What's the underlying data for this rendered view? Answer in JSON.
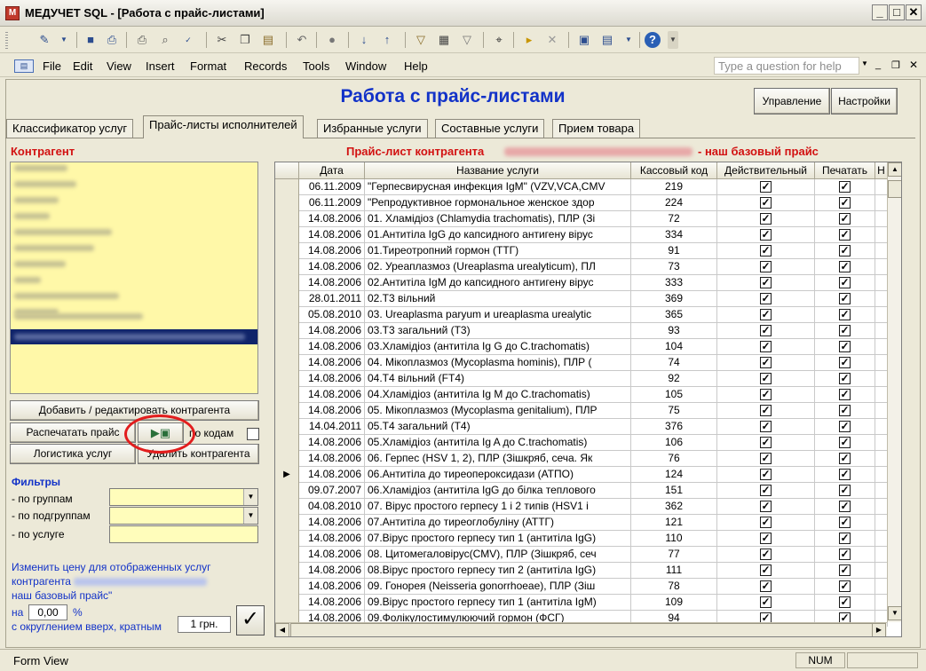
{
  "window": {
    "title": "МЕДУЧЕТ SQL - [Работа с прайс-листами]",
    "app_icon_letter": "M"
  },
  "menu": [
    "File",
    "Edit",
    "View",
    "Insert",
    "Format",
    "Records",
    "Tools",
    "Window",
    "Help"
  ],
  "help_placeholder": "Type a question for help",
  "form": {
    "title": "Работа с прайс-листами",
    "buttons": {
      "manage": "Управление",
      "settings": "Настройки"
    },
    "tabs": [
      "Классификатор услуг",
      "Прайс-листы исполнителей",
      "Избранные услуги",
      "Составные услуги",
      "Прием товара"
    ],
    "active_tab": 1
  },
  "left": {
    "title": "Контрагент",
    "buttons": {
      "add_edit": "Добавить / редактировать контрагента",
      "print_price": "Распечатать прайс",
      "by_codes": "по кодам",
      "logistics": "Логистика услуг",
      "delete": "Удалить контрагента"
    },
    "filters": {
      "title": "Фильтры",
      "by_group": "- по группам",
      "by_subgroup": "- по подгруппам",
      "by_service": "- по услуге"
    },
    "price_change": {
      "line1": "Изменить цену для отображенных услуг",
      "line2_prefix": "контрагента",
      "line3": "наш базовый прайс\"",
      "on_label": "на",
      "percent_value": "0,00",
      "percent_sign": "%",
      "rounding_label": "с округлением вверх, кратным",
      "rounding_value": "1 грн."
    }
  },
  "right": {
    "title_prefix": "Прайс-лист контрагента",
    "title_suffix": "- наш базовый прайс"
  },
  "grid": {
    "columns": [
      "Дата",
      "Название услуги",
      "Кассовый код",
      "Действительный",
      "Печатать",
      "Н"
    ],
    "current_row": 18,
    "rows": [
      [
        "06.11.2009",
        "\"Герпесвирусная инфекция IgM\" (VZV,VCA,CMV",
        "219"
      ],
      [
        "06.11.2009",
        "\"Репродуктивное гормональное женское здор",
        "224"
      ],
      [
        "14.08.2006",
        "01. Хламідіоз (Chlamydia trachomatis), ПЛР (Зі",
        "72"
      ],
      [
        "14.08.2006",
        "01.Антитіла IgG до капсидного антигену вірус",
        "334"
      ],
      [
        "14.08.2006",
        "01.Тиреотропний гормон (ТТГ)",
        "91"
      ],
      [
        "14.08.2006",
        "02. Уреаплазмоз (Ureaplasma urealyticum), ПЛ",
        "73"
      ],
      [
        "14.08.2006",
        "02.Антитіла IgM до капсидного антигену вірус",
        "333"
      ],
      [
        "28.01.2011",
        "02.Т3 вільний",
        "369"
      ],
      [
        "05.08.2010",
        "03. Ureaplasma paryum и ureaplasma urealytic",
        "365"
      ],
      [
        "14.08.2006",
        "03.Т3 загальний (Т3)",
        "93"
      ],
      [
        "14.08.2006",
        "03.Хламідіоз (антитіла Ig G до C.trachomatis)",
        "104"
      ],
      [
        "14.08.2006",
        "04. Мікоплазмоз (Mycoplasma hominis), ПЛР (",
        "74"
      ],
      [
        "14.08.2006",
        "04.Т4 вільний (FT4)",
        "92"
      ],
      [
        "14.08.2006",
        "04.Хламідіоз (антитіла Ig M до C.trachomatis)",
        "105"
      ],
      [
        "14.08.2006",
        "05. Мікоплазмоз (Mycoplasma genitalium), ПЛР",
        "75"
      ],
      [
        "14.04.2011",
        "05.Т4 загальний (Т4)",
        "376"
      ],
      [
        "14.08.2006",
        "05.Хламідіоз (антитіла Ig A до C.trachomatis)",
        "106"
      ],
      [
        "14.08.2006",
        "06. Герпес (HSV 1, 2), ПЛР (Зішкряб, сеча. Як",
        "76"
      ],
      [
        "14.08.2006",
        "06.Антитіла до тиреопероксидази (АТПО)",
        "124"
      ],
      [
        "09.07.2007",
        "06.Хламідіоз (антитіла IgG до білка теплового",
        "151"
      ],
      [
        "04.08.2010",
        "07. Вірус простого герпесу 1 і 2 типів (HSV1 і",
        "362"
      ],
      [
        "14.08.2006",
        "07.Антитіла до тиреоглобуліну (АТТГ)",
        "121"
      ],
      [
        "14.08.2006",
        "07.Вірус простого герпесу тип 1 (антитіла IgG)",
        "110"
      ],
      [
        "14.08.2006",
        "08. Цитомегаловірус(CMV), ПЛР (Зішкряб, сеч",
        "77"
      ],
      [
        "14.08.2006",
        "08.Вірус простого герпесу тип 2 (антитіла IgG)",
        "111"
      ],
      [
        "14.08.2006",
        "09. Гонорея (Neisseria gonorrhoeae), ПЛР (Зіш",
        "78"
      ],
      [
        "14.08.2006",
        "09.Вірус простого герпесу тип 1 (антитіла IgM)",
        "109"
      ],
      [
        "14.08.2006",
        "09.Фолікулостимулюючий гормон (ФСГ)",
        "94"
      ]
    ]
  },
  "status": {
    "left": "Form View",
    "num": "NUM"
  }
}
